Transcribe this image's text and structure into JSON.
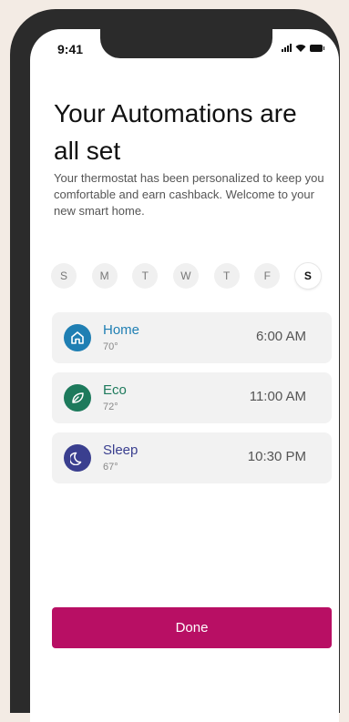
{
  "status_bar": {
    "time": "9:41"
  },
  "header": {
    "title": "Your Automations are all set",
    "subtitle": "Your thermostat has been personalized to keep you comfortable and earn cashback. Welcome to your new smart home."
  },
  "days": [
    {
      "label": "S",
      "active": false
    },
    {
      "label": "M",
      "active": false
    },
    {
      "label": "T",
      "active": false
    },
    {
      "label": "W",
      "active": false
    },
    {
      "label": "T",
      "active": false
    },
    {
      "label": "F",
      "active": false
    },
    {
      "label": "S",
      "active": true
    }
  ],
  "automations": [
    {
      "name": "Home",
      "temp": "70°",
      "time": "6:00 AM",
      "icon": "home-icon",
      "color": "#1f7fb3"
    },
    {
      "name": "Eco",
      "temp": "72°",
      "time": "11:00 AM",
      "icon": "leaf-icon",
      "color": "#1d7a5c"
    },
    {
      "name": "Sleep",
      "temp": "67°",
      "time": "10:30 PM",
      "icon": "moon-icon",
      "color": "#3a3f8f"
    }
  ],
  "done_button": {
    "label": "Done",
    "color": "#b80f64"
  }
}
